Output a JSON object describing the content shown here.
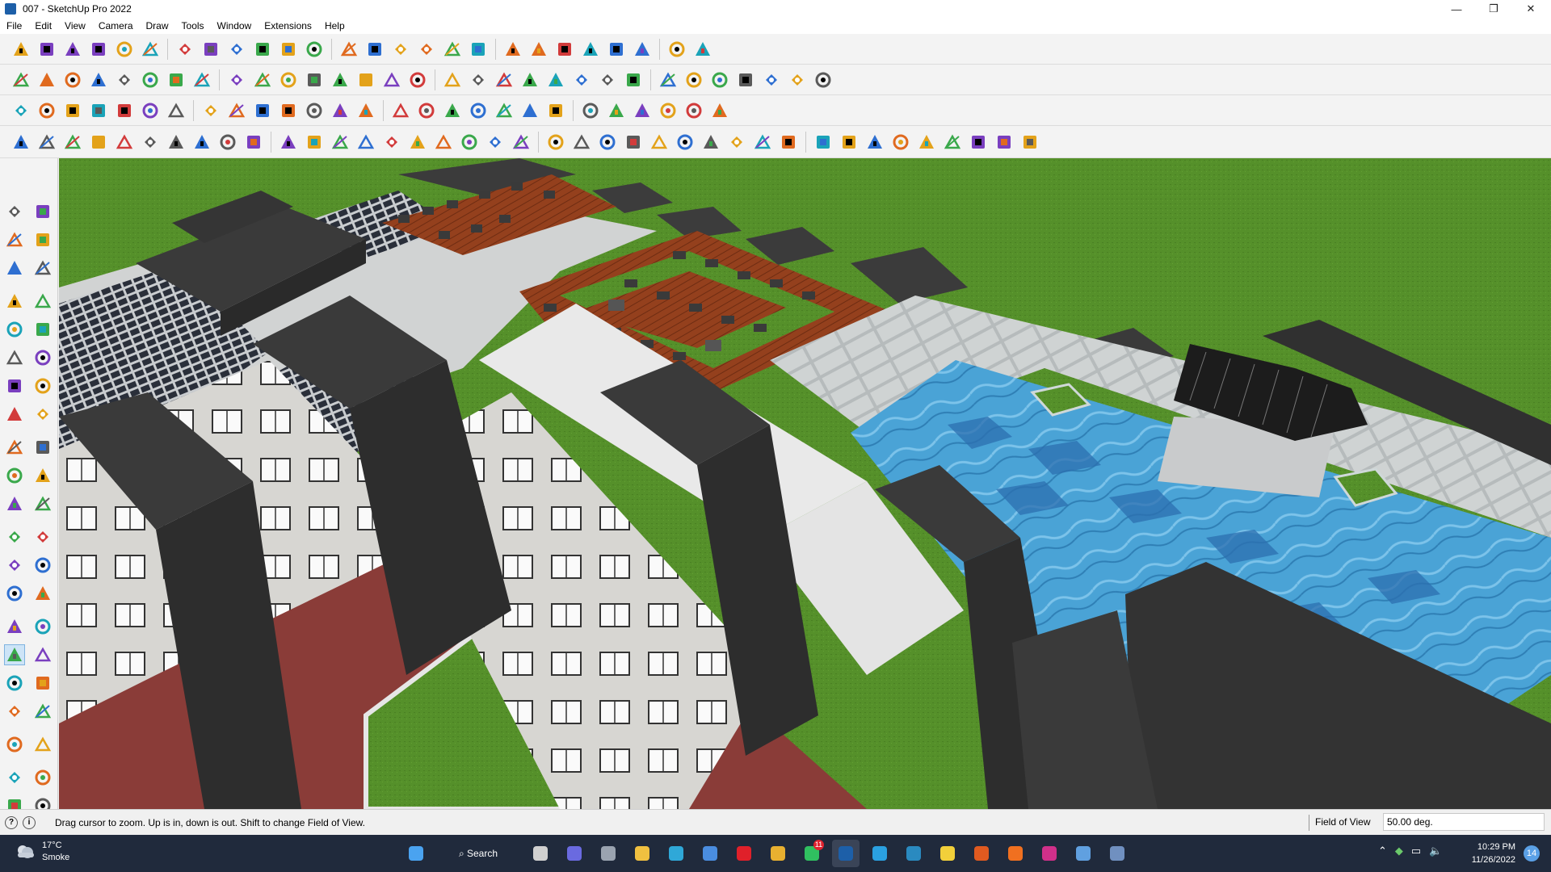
{
  "window": {
    "title": "007 - SketchUp Pro 2022",
    "controls": {
      "minimize": "—",
      "maximize": "❐",
      "close": "✕"
    }
  },
  "menu": [
    "File",
    "Edit",
    "View",
    "Camera",
    "Draw",
    "Tools",
    "Window",
    "Extensions",
    "Help"
  ],
  "toolbars": {
    "row1_icons": [
      "zoom-window",
      "select",
      "eraser",
      "pencil-line",
      "lasso",
      "rectangle",
      "push-pull",
      "follow-me",
      "move",
      "rotate",
      "scale",
      "tape-measure",
      "text",
      "paint-bucket",
      "orbit",
      "pan",
      "zoom",
      "zoom-extents",
      "standard-view",
      "x-ray",
      "wireframe",
      "shaded",
      "profile",
      "axis",
      "styles",
      "sandbox"
    ],
    "row2_icons": [
      "warehouse",
      "iso-view",
      "top-view",
      "front-view",
      "right-view",
      "back-view",
      "left-view",
      "bottom-view",
      "section-plane",
      "section-fill",
      "section-cut",
      "paint",
      "freehand",
      "arc",
      "two-point-arc",
      "circle",
      "polygon",
      "ellipse",
      "rotated-rect",
      "offset",
      "intersect",
      "follow-edge",
      "outer-shell",
      "soften",
      "red-pin",
      "blue-pin",
      "green-pin",
      "orange-pin",
      "magenta-pin",
      "model-info",
      "components"
    ],
    "row3_icons": [
      "3d-warehouse",
      "extension-warehouse",
      "layout",
      "send-to-layout",
      "advanced-camera",
      "scene",
      "dimension",
      "protractor",
      "axes",
      "text-3d",
      "solid-union",
      "solid-subtract",
      "solid-trim",
      "solid-intersect",
      "solid-split",
      "shell",
      "camera-tools",
      "walk",
      "look-around",
      "position-camera",
      "section-display",
      "fog",
      "shadows",
      "sun",
      "layers",
      "outliner",
      "instructor"
    ],
    "row4_icons": [
      "blue-plane",
      "blue-plane-2",
      "yellow-plane",
      "green-plane",
      "red-plane",
      "grey-plane",
      "curve-tool",
      "red-square",
      "grid-block",
      "flag",
      "box-open",
      "link",
      "hook",
      "path-nodes",
      "cross",
      "plus",
      "blue-cross",
      "cone",
      "sun-triangle",
      "warning",
      "magnet",
      "no-magnet",
      "spiral",
      "move-arrows",
      "bucket",
      "undo-arc",
      "tree",
      "gear-stack",
      "settings-red",
      "anchor",
      "red-box",
      "swatches",
      "layers-grid",
      "grid-orange",
      "grid-orange-2",
      "grid-yellow",
      "close-red",
      "dashed-circle",
      "qr-grid"
    ]
  },
  "palette_icons": [
    [
      "select-arrow-icon",
      "orbit-icon"
    ],
    [
      "paint-bucket-icon",
      "eraser-icon"
    ],
    [
      "component-icon",
      "tape-pencil-icon"
    ],
    [
      "line-icon",
      "freehand-icon"
    ],
    [
      "rectangle-icon",
      "rotated-rectangle-icon"
    ],
    [
      "circle-icon",
      "polygon-icon"
    ],
    [
      "arc-icon",
      "two-point-arc-icon"
    ],
    [
      "three-point-arc-icon",
      "pie-icon"
    ],
    [
      "move-icon",
      "push-pull-icon"
    ],
    [
      "rotate-icon",
      "follow-me-icon"
    ],
    [
      "scale-icon",
      "offset-icon"
    ],
    [
      "tape-measure-icon",
      "dimension-icon"
    ],
    [
      "protractor-icon",
      "text-icon"
    ],
    [
      "axes-icon",
      "3d-text-icon"
    ],
    [
      "orbit-hand-icon",
      "pan-hand-icon"
    ],
    [
      "zoom-icon",
      "zoom-window-icon"
    ],
    [
      "zoom-extents-icon",
      "zoom-previous-icon"
    ],
    [
      "position-camera-icon",
      "look-around-icon"
    ],
    [
      "walk-icon",
      "section-plane-icon"
    ],
    [
      "sandbox-icon",
      "smoove-icon"
    ],
    [
      "stamp-icon",
      "drape-icon"
    ]
  ],
  "status": {
    "message": "Drag cursor to zoom.  Up is in, down is out. Shift to change Field of View.",
    "measurements_label": "Field of View",
    "measurements_value": "50.00 deg."
  },
  "taskbar": {
    "weather_temp": "17°C",
    "weather_desc": "Smoke",
    "search_label": "Search",
    "apps": [
      "windows-start",
      "search",
      "task-view",
      "teams-chat",
      "calculator",
      "file-explorer",
      "edge",
      "store",
      "opera",
      "chrome",
      "whatsapp",
      "sketchup",
      "telegram",
      "sketchup-layout",
      "sticky-notes",
      "g-app",
      "soundcloud",
      "instagram",
      "photos",
      "snipping-tool"
    ],
    "whatsapp_badge": "11",
    "time": "10:29 PM",
    "date": "11/26/2022",
    "notifications": "14"
  },
  "colors": {
    "grass": "#4f8a26",
    "roof": "#3d3d3d",
    "wall": "#d6d6d2",
    "deck": "#8b3b1c",
    "pool": "#3e94c7",
    "road": "#8c3e3a",
    "paving": "#bfc4c4"
  }
}
